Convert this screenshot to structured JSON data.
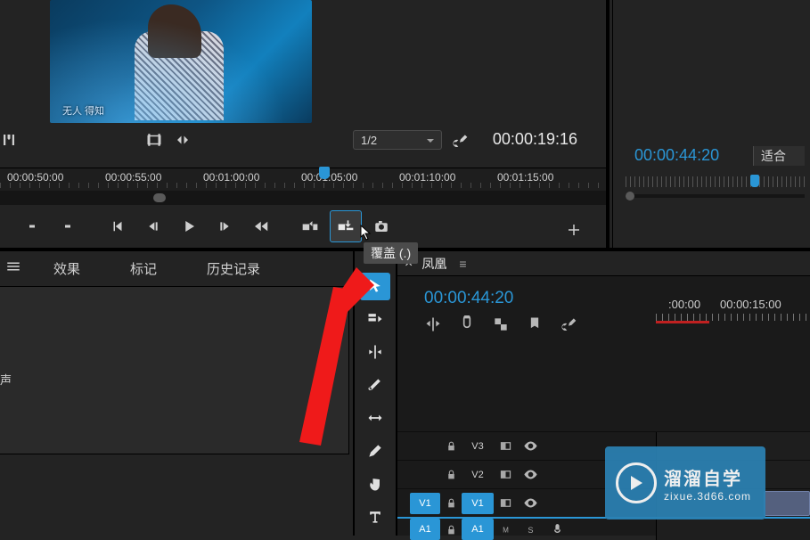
{
  "source": {
    "caption": "无人 得知",
    "zoom": "1/2",
    "timecode": "00:00:19:16",
    "ruler": [
      "00:00:50:00",
      "00:00:55:00",
      "00:01:00:00",
      "00:01:05:00",
      "00:01:10:00",
      "00:01:15:00"
    ]
  },
  "program": {
    "timecode": "00:00:44:20",
    "fit": "适合"
  },
  "tooltip": "覆盖 (.)",
  "tabs": {
    "effects": "效果",
    "markers": "标记",
    "history": "历史记录",
    "left_label": "声"
  },
  "timeline": {
    "seq_name": "凤凰",
    "timecode": "00:00:44:20",
    "ruler": [
      ":00:00",
      "00:00:15:00"
    ],
    "tracks": {
      "v3": "V3",
      "v2": "V2",
      "v1_src": "V1",
      "v1_tgt": "V1",
      "a1_src": "A1",
      "a1_tgt": "A1"
    }
  },
  "watermark": {
    "title": "溜溜自学",
    "url": "zixue.3d66.com"
  }
}
